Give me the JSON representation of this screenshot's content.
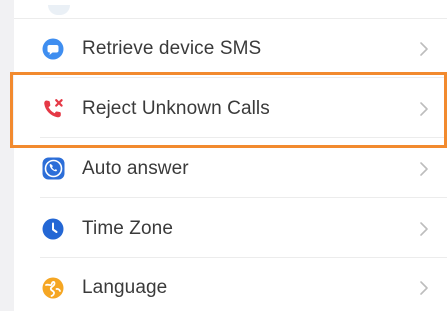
{
  "settings_list": {
    "items": [
      {
        "label": "Retrieve device SMS",
        "icon": "sms-chat-icon",
        "color": "#3f8ef0"
      },
      {
        "label": "Reject Unknown Calls",
        "icon": "reject-call-icon",
        "color": "#e53946"
      },
      {
        "label": "Auto answer",
        "icon": "auto-answer-icon",
        "color": "#2c6ed8"
      },
      {
        "label": "Time Zone",
        "icon": "clock-icon",
        "color": "#2467d4"
      },
      {
        "label": "Language",
        "icon": "globe-icon",
        "color": "#f5a623"
      }
    ],
    "chevron_icon": "chevron-right-icon",
    "highlight_color": "#f28a2e"
  }
}
